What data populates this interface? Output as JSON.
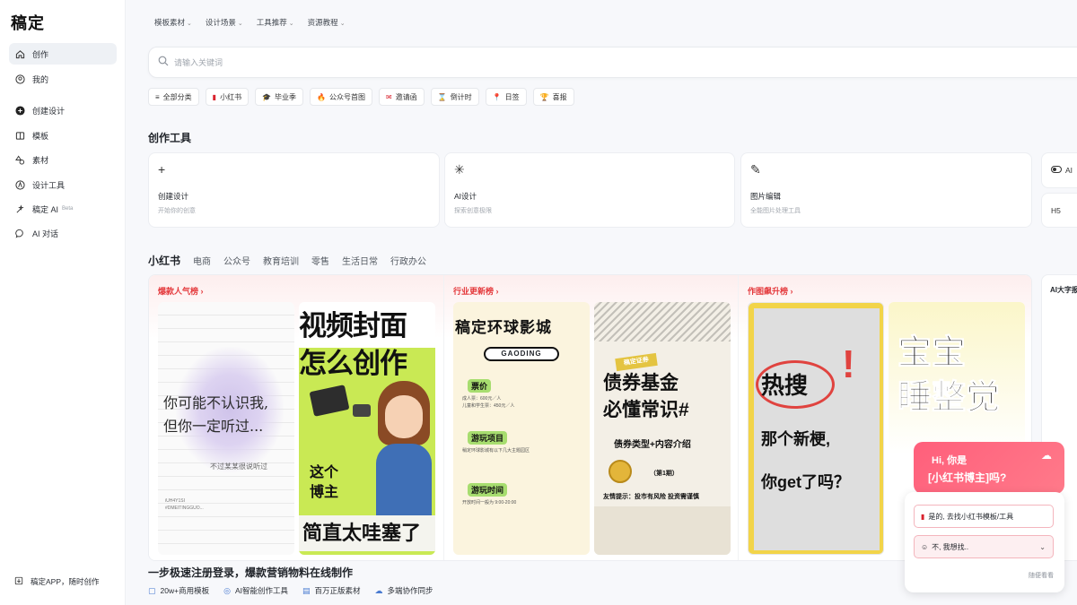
{
  "app": {
    "logo": "稿定"
  },
  "sidebar": {
    "items": [
      {
        "label": "创作",
        "icon": "home-icon"
      },
      {
        "label": "我的",
        "icon": "user-icon"
      },
      {
        "label": "创建设计",
        "icon": "plus-circle-icon"
      },
      {
        "label": "模板",
        "icon": "template-icon"
      },
      {
        "label": "素材",
        "icon": "shapes-icon"
      },
      {
        "label": "设计工具",
        "icon": "compass-icon"
      },
      {
        "label": "稿定 AI",
        "icon": "ai-magic-icon",
        "badge": "Beta"
      },
      {
        "label": "AI 对话",
        "icon": "chat-bubble-icon"
      }
    ],
    "footer": "稿定APP，随时创作"
  },
  "topnav": [
    "模板素材",
    "设计场景",
    "工具推荐",
    "资源教程"
  ],
  "search": {
    "placeholder": "请输入关键词"
  },
  "categories": [
    {
      "label": "全部分类",
      "icon": "≡"
    },
    {
      "label": "小红书",
      "icon": "▮"
    },
    {
      "label": "毕业季",
      "icon": "🎓"
    },
    {
      "label": "公众号首图",
      "icon": "🔥"
    },
    {
      "label": "邀请函",
      "icon": "✉"
    },
    {
      "label": "倒计时",
      "icon": "⌛"
    },
    {
      "label": "日签",
      "icon": "📍"
    },
    {
      "label": "喜报",
      "icon": "🏆"
    }
  ],
  "tools": {
    "title": "创作工具",
    "cards": [
      {
        "icon": "+",
        "title": "创建设计",
        "sub": "开始你的创意"
      },
      {
        "icon": "✳",
        "title": "AI设计",
        "sub": "探索创意极限"
      },
      {
        "icon": "✎",
        "title": "图片编辑",
        "sub": "全能图片处理工具"
      }
    ],
    "mini": [
      "AI",
      "H5"
    ]
  },
  "tabs": [
    "小红书",
    "电商",
    "公众号",
    "教育培训",
    "零售",
    "生活日常",
    "行政办公"
  ],
  "rankings": {
    "columns": [
      {
        "title": "爆款人气榜 ›"
      },
      {
        "title": "行业更新榜 ›"
      },
      {
        "title": "作图飙升榜 ›"
      }
    ],
    "side_label": "AI大字报",
    "posters": {
      "p1": {
        "line1": "你可能不认识我,",
        "line2": "但你一定听过...",
        "line3": "不过某某很说听过",
        "tiny1": "iUH4Y1SI",
        "tiny2": "#DMEITINGGUO..."
      },
      "p2": {
        "line1": "视频封面",
        "line2": "怎么创作",
        "mid1": "这个",
        "mid2": "博主",
        "bottom": "简直太哇塞了"
      },
      "p3": {
        "title": "稿定环球影城",
        "badge": "GAODING",
        "l1": "票价",
        "l2": "游玩项目",
        "l3": "游玩时间",
        "tx1": "成人票：600元／人",
        "tx2": "儿童和学生票：450元／人",
        "tx3": "稍定环球影城有以下几大主题园区",
        "tx4": "开放时间一般为 9:00-20:00"
      },
      "p4": {
        "tag": "稿定证券",
        "line1": "债券基金",
        "line2": "必懂常识#",
        "sub": "债券类型+内容介绍",
        "part": "（第1期）",
        "foot": "友情提示：投市有风险 投资需谨慎"
      },
      "p5": {
        "t1": "热搜",
        "bang": "!",
        "t2a": "那个新梗,",
        "t2b": "你get了吗？"
      },
      "p6": {
        "t1a": "宝宝",
        "t1b": "睡整觉"
      }
    }
  },
  "banner": {
    "headline": "一步极速注册登录，爆款营销物料在线制作",
    "features": [
      {
        "icon": "▢",
        "label": "20w+商用模板"
      },
      {
        "icon": "◎",
        "label": "AI智能创作工具"
      },
      {
        "icon": "▤",
        "label": "百万正版素材"
      },
      {
        "icon": "☁",
        "label": "多端协作同步"
      }
    ]
  },
  "chat": {
    "greet": "Hi, 你是",
    "question": "[小红书博主]吗?",
    "opt1": "是的, 去找小红书模板/工具",
    "opt2": "不, 我想找..",
    "browse": "随便看看"
  }
}
